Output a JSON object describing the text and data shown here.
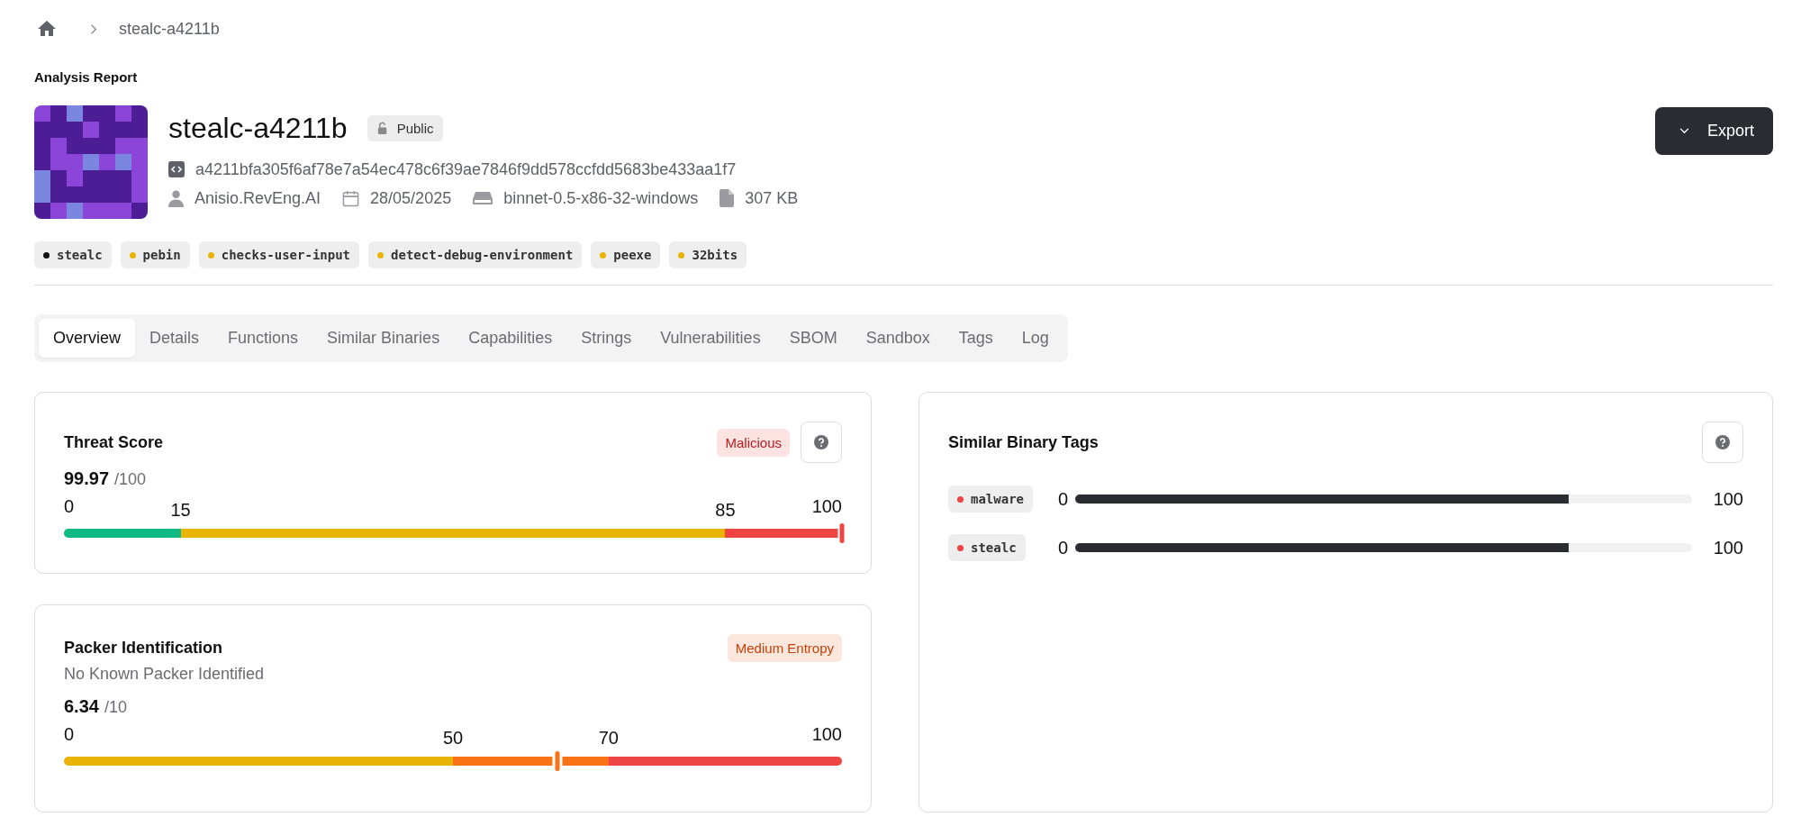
{
  "breadcrumb": {
    "current": "stealc-a4211b"
  },
  "section_title": "Analysis Report",
  "binary": {
    "name": "stealc-a4211b",
    "visibility": "Public",
    "hash": "a4211bfa305f6af78e7a54ec478c6f39ae7846f9dd578ccfdd5683be433aa1f7",
    "owner": "Anisio.RevEng.AI",
    "date": "28/05/2025",
    "model": "binnet-0.5-x86-32-windows",
    "size": "307 KB"
  },
  "export_button": "Export",
  "tags": [
    {
      "label": "stealc",
      "color": "#111111"
    },
    {
      "label": "pebin",
      "color": "#eab308"
    },
    {
      "label": "checks-user-input",
      "color": "#eab308"
    },
    {
      "label": "detect-debug-environment",
      "color": "#eab308"
    },
    {
      "label": "peexe",
      "color": "#eab308"
    },
    {
      "label": "32bits",
      "color": "#eab308"
    }
  ],
  "tabs": [
    {
      "label": "Overview",
      "selected": true
    },
    {
      "label": "Details",
      "selected": false
    },
    {
      "label": "Functions",
      "selected": false
    },
    {
      "label": "Similar Binaries",
      "selected": false
    },
    {
      "label": "Capabilities",
      "selected": false
    },
    {
      "label": "Strings",
      "selected": false
    },
    {
      "label": "Vulnerabilities",
      "selected": false
    },
    {
      "label": "SBOM",
      "selected": false
    },
    {
      "label": "Sandbox",
      "selected": false
    },
    {
      "label": "Tags",
      "selected": false
    },
    {
      "label": "Log",
      "selected": false
    }
  ],
  "threat_score": {
    "title": "Threat Score",
    "badge": {
      "label": "Malicious",
      "kind": "danger"
    },
    "score": "99.97",
    "max": "/100",
    "level": 0.9997,
    "ticks": [
      "0",
      "15",
      "85",
      "100"
    ],
    "segments": [
      {
        "color": "#10b981"
      },
      {
        "color": "#eab308"
      },
      {
        "color": "#ef4444"
      }
    ]
  },
  "packer": {
    "title": "Packer Identification",
    "badge": {
      "label": "Medium Entropy",
      "kind": "warning"
    },
    "subtitle": "No Known Packer Identified",
    "score": "6.34",
    "max": "/10",
    "level": 0.634,
    "ticks": [
      "0",
      "50",
      "70",
      "100"
    ],
    "segments": [
      {
        "color": "#eab308"
      },
      {
        "color": "#f97316"
      },
      {
        "color": "#ef4444"
      }
    ]
  },
  "similar_tags": {
    "title": "Similar Binary Tags",
    "rows": [
      {
        "label": "malware",
        "color": "#ef4444",
        "min": "0",
        "max": "100",
        "level": 0.8
      },
      {
        "label": "stealc",
        "color": "#ef4444",
        "min": "0",
        "max": "100",
        "level": 0.8
      }
    ]
  }
}
